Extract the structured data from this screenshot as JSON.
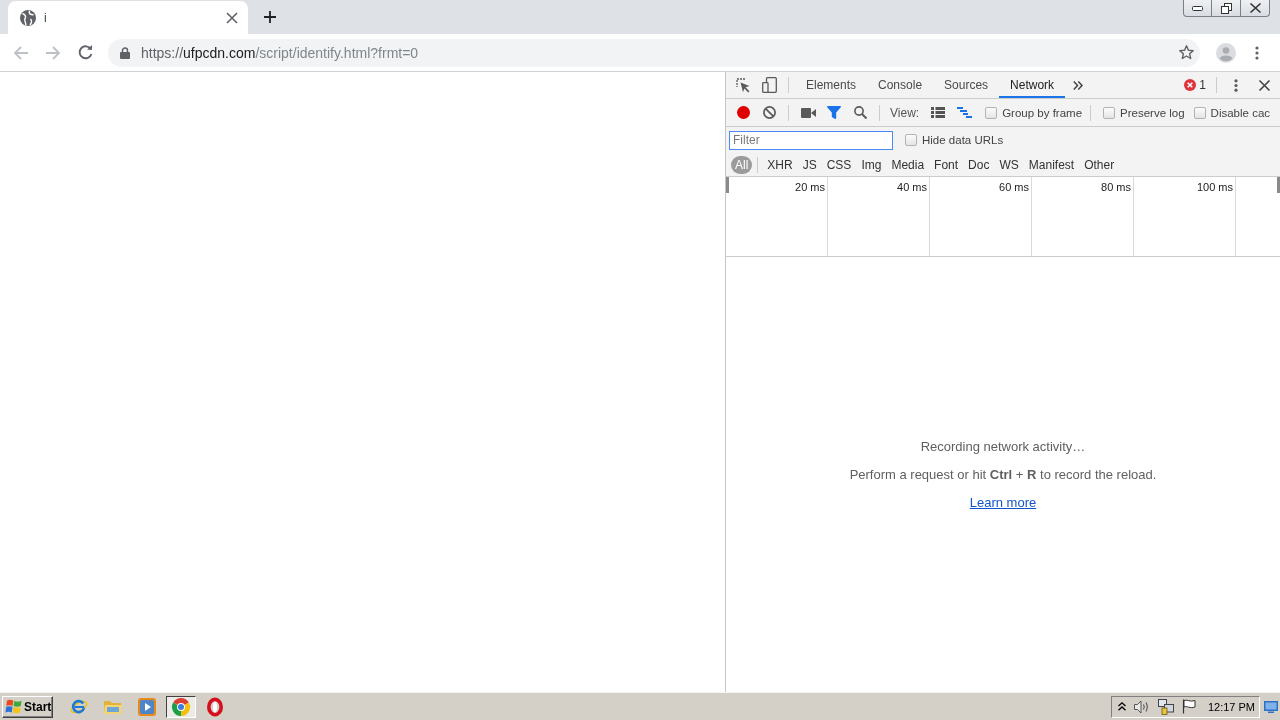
{
  "browser": {
    "tabs": [
      {
        "title": "i",
        "selected": true
      }
    ],
    "navigation": {
      "back_disabled": true,
      "forward_disabled": true
    },
    "address_bar": {
      "scheme": "https://",
      "host": "ufpcdn.com",
      "path": "/script/identify.html?frmt=0"
    }
  },
  "devtools": {
    "panels": [
      {
        "label": "Elements",
        "selected": false
      },
      {
        "label": "Console",
        "selected": false
      },
      {
        "label": "Sources",
        "selected": false
      },
      {
        "label": "Network",
        "selected": true
      }
    ],
    "error_count": "1",
    "toolbar": {
      "recording": true,
      "filter_shown": true,
      "view_label": "View:",
      "large_rows": false,
      "overview_shown": true,
      "options": [
        {
          "label": "Group by frame",
          "checked": false
        },
        {
          "label": "Preserve log",
          "checked": false
        },
        {
          "label": "Disable cac",
          "checked": false
        }
      ]
    },
    "filter": {
      "placeholder": "Filter",
      "hide_data_urls": {
        "label": "Hide data URLs",
        "checked": false
      }
    },
    "types": [
      {
        "label": "All",
        "selected": true
      },
      {
        "label": "XHR",
        "selected": false
      },
      {
        "label": "JS",
        "selected": false
      },
      {
        "label": "CSS",
        "selected": false
      },
      {
        "label": "Img",
        "selected": false
      },
      {
        "label": "Media",
        "selected": false
      },
      {
        "label": "Font",
        "selected": false
      },
      {
        "label": "Doc",
        "selected": false
      },
      {
        "label": "WS",
        "selected": false
      },
      {
        "label": "Manifest",
        "selected": false
      },
      {
        "label": "Other",
        "selected": false
      }
    ],
    "overview": {
      "ticks": [
        "20 ms",
        "40 ms",
        "60 ms",
        "80 ms",
        "100 ms"
      ]
    },
    "empty_state": {
      "title": "Recording network activity…",
      "hint": "Perform a request or hit **Ctrl** + **R** to record the reload.",
      "link": "Learn more"
    }
  },
  "taskbar": {
    "start": "Start",
    "apps": [
      {
        "kind": "e",
        "active": false
      },
      {
        "kind": "folder",
        "active": false
      },
      {
        "kind": "player",
        "active": false
      },
      {
        "kind": "ring",
        "active": true
      },
      {
        "kind": "o",
        "active": false
      }
    ],
    "clock": "12:17 PM"
  }
}
